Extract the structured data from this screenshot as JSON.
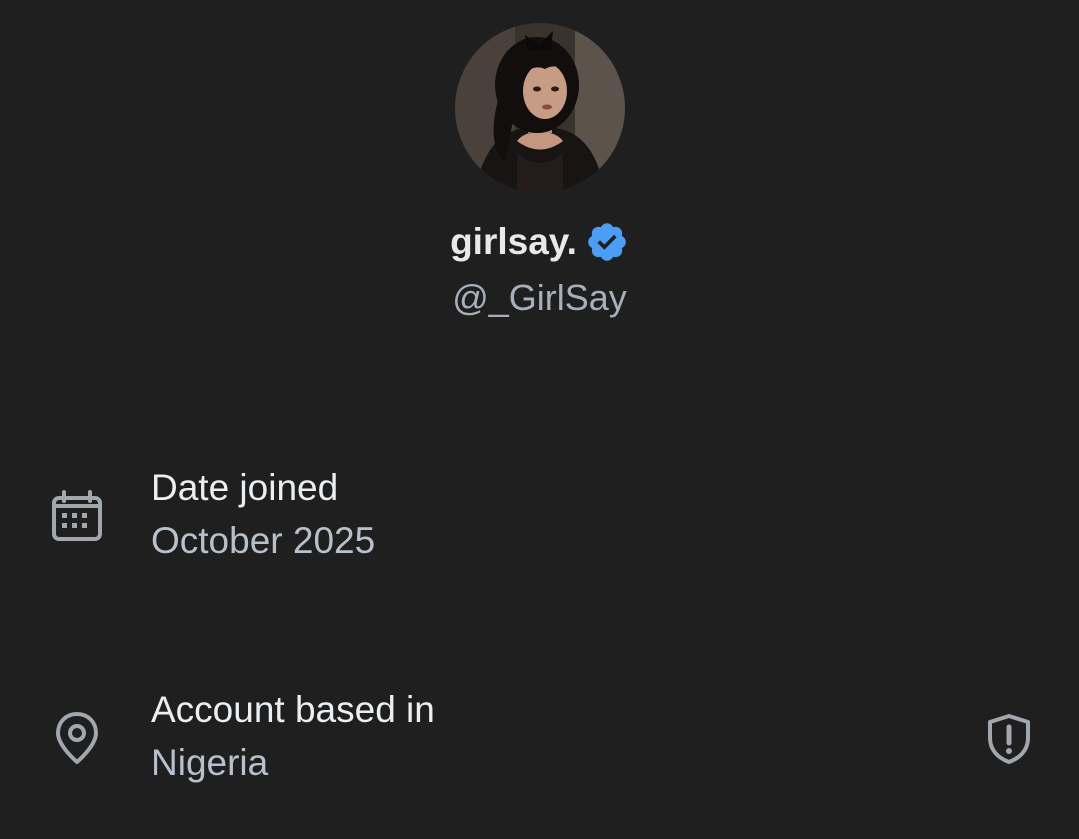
{
  "profile": {
    "display_name": "girlsay.",
    "handle": "@_GirlSay",
    "verified": true,
    "verified_color": "#4a9ff5",
    "avatar_icon": "profile-photo"
  },
  "details": {
    "date_joined": {
      "icon": "calendar-icon",
      "title": "Date joined",
      "value": "October 2025"
    },
    "account_based_in": {
      "icon": "location-pin-icon",
      "title": "Account based in",
      "value": "Nigeria",
      "trailing_icon": "shield-alert-icon"
    }
  },
  "colors": {
    "background": "#1f1f1f",
    "primary_text": "#e7e9ea",
    "secondary_text": "#a7b0ba",
    "icon_gray": "#a1a7ad"
  }
}
